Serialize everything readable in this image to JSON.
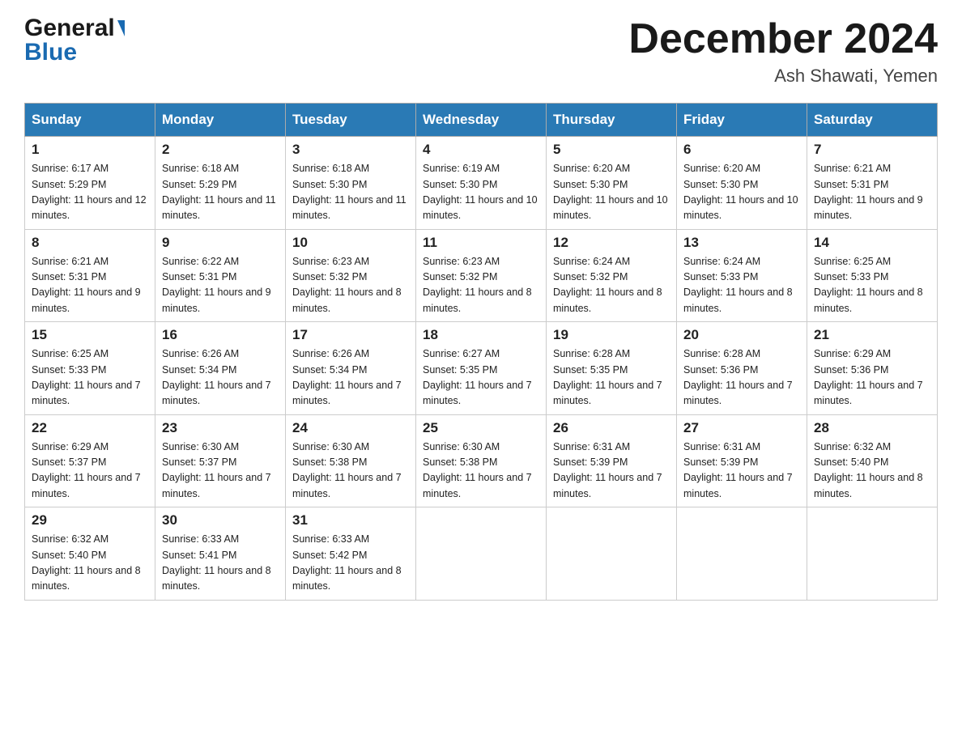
{
  "header": {
    "logo_line1": "General",
    "logo_arrow": "▶",
    "logo_line2": "Blue",
    "month_title": "December 2024",
    "location": "Ash Shawati, Yemen"
  },
  "calendar": {
    "days_of_week": [
      "Sunday",
      "Monday",
      "Tuesday",
      "Wednesday",
      "Thursday",
      "Friday",
      "Saturday"
    ],
    "weeks": [
      [
        {
          "day": "1",
          "sunrise": "Sunrise: 6:17 AM",
          "sunset": "Sunset: 5:29 PM",
          "daylight": "Daylight: 11 hours and 12 minutes."
        },
        {
          "day": "2",
          "sunrise": "Sunrise: 6:18 AM",
          "sunset": "Sunset: 5:29 PM",
          "daylight": "Daylight: 11 hours and 11 minutes."
        },
        {
          "day": "3",
          "sunrise": "Sunrise: 6:18 AM",
          "sunset": "Sunset: 5:30 PM",
          "daylight": "Daylight: 11 hours and 11 minutes."
        },
        {
          "day": "4",
          "sunrise": "Sunrise: 6:19 AM",
          "sunset": "Sunset: 5:30 PM",
          "daylight": "Daylight: 11 hours and 10 minutes."
        },
        {
          "day": "5",
          "sunrise": "Sunrise: 6:20 AM",
          "sunset": "Sunset: 5:30 PM",
          "daylight": "Daylight: 11 hours and 10 minutes."
        },
        {
          "day": "6",
          "sunrise": "Sunrise: 6:20 AM",
          "sunset": "Sunset: 5:30 PM",
          "daylight": "Daylight: 11 hours and 10 minutes."
        },
        {
          "day": "7",
          "sunrise": "Sunrise: 6:21 AM",
          "sunset": "Sunset: 5:31 PM",
          "daylight": "Daylight: 11 hours and 9 minutes."
        }
      ],
      [
        {
          "day": "8",
          "sunrise": "Sunrise: 6:21 AM",
          "sunset": "Sunset: 5:31 PM",
          "daylight": "Daylight: 11 hours and 9 minutes."
        },
        {
          "day": "9",
          "sunrise": "Sunrise: 6:22 AM",
          "sunset": "Sunset: 5:31 PM",
          "daylight": "Daylight: 11 hours and 9 minutes."
        },
        {
          "day": "10",
          "sunrise": "Sunrise: 6:23 AM",
          "sunset": "Sunset: 5:32 PM",
          "daylight": "Daylight: 11 hours and 8 minutes."
        },
        {
          "day": "11",
          "sunrise": "Sunrise: 6:23 AM",
          "sunset": "Sunset: 5:32 PM",
          "daylight": "Daylight: 11 hours and 8 minutes."
        },
        {
          "day": "12",
          "sunrise": "Sunrise: 6:24 AM",
          "sunset": "Sunset: 5:32 PM",
          "daylight": "Daylight: 11 hours and 8 minutes."
        },
        {
          "day": "13",
          "sunrise": "Sunrise: 6:24 AM",
          "sunset": "Sunset: 5:33 PM",
          "daylight": "Daylight: 11 hours and 8 minutes."
        },
        {
          "day": "14",
          "sunrise": "Sunrise: 6:25 AM",
          "sunset": "Sunset: 5:33 PM",
          "daylight": "Daylight: 11 hours and 8 minutes."
        }
      ],
      [
        {
          "day": "15",
          "sunrise": "Sunrise: 6:25 AM",
          "sunset": "Sunset: 5:33 PM",
          "daylight": "Daylight: 11 hours and 7 minutes."
        },
        {
          "day": "16",
          "sunrise": "Sunrise: 6:26 AM",
          "sunset": "Sunset: 5:34 PM",
          "daylight": "Daylight: 11 hours and 7 minutes."
        },
        {
          "day": "17",
          "sunrise": "Sunrise: 6:26 AM",
          "sunset": "Sunset: 5:34 PM",
          "daylight": "Daylight: 11 hours and 7 minutes."
        },
        {
          "day": "18",
          "sunrise": "Sunrise: 6:27 AM",
          "sunset": "Sunset: 5:35 PM",
          "daylight": "Daylight: 11 hours and 7 minutes."
        },
        {
          "day": "19",
          "sunrise": "Sunrise: 6:28 AM",
          "sunset": "Sunset: 5:35 PM",
          "daylight": "Daylight: 11 hours and 7 minutes."
        },
        {
          "day": "20",
          "sunrise": "Sunrise: 6:28 AM",
          "sunset": "Sunset: 5:36 PM",
          "daylight": "Daylight: 11 hours and 7 minutes."
        },
        {
          "day": "21",
          "sunrise": "Sunrise: 6:29 AM",
          "sunset": "Sunset: 5:36 PM",
          "daylight": "Daylight: 11 hours and 7 minutes."
        }
      ],
      [
        {
          "day": "22",
          "sunrise": "Sunrise: 6:29 AM",
          "sunset": "Sunset: 5:37 PM",
          "daylight": "Daylight: 11 hours and 7 minutes."
        },
        {
          "day": "23",
          "sunrise": "Sunrise: 6:30 AM",
          "sunset": "Sunset: 5:37 PM",
          "daylight": "Daylight: 11 hours and 7 minutes."
        },
        {
          "day": "24",
          "sunrise": "Sunrise: 6:30 AM",
          "sunset": "Sunset: 5:38 PM",
          "daylight": "Daylight: 11 hours and 7 minutes."
        },
        {
          "day": "25",
          "sunrise": "Sunrise: 6:30 AM",
          "sunset": "Sunset: 5:38 PM",
          "daylight": "Daylight: 11 hours and 7 minutes."
        },
        {
          "day": "26",
          "sunrise": "Sunrise: 6:31 AM",
          "sunset": "Sunset: 5:39 PM",
          "daylight": "Daylight: 11 hours and 7 minutes."
        },
        {
          "day": "27",
          "sunrise": "Sunrise: 6:31 AM",
          "sunset": "Sunset: 5:39 PM",
          "daylight": "Daylight: 11 hours and 7 minutes."
        },
        {
          "day": "28",
          "sunrise": "Sunrise: 6:32 AM",
          "sunset": "Sunset: 5:40 PM",
          "daylight": "Daylight: 11 hours and 8 minutes."
        }
      ],
      [
        {
          "day": "29",
          "sunrise": "Sunrise: 6:32 AM",
          "sunset": "Sunset: 5:40 PM",
          "daylight": "Daylight: 11 hours and 8 minutes."
        },
        {
          "day": "30",
          "sunrise": "Sunrise: 6:33 AM",
          "sunset": "Sunset: 5:41 PM",
          "daylight": "Daylight: 11 hours and 8 minutes."
        },
        {
          "day": "31",
          "sunrise": "Sunrise: 6:33 AM",
          "sunset": "Sunset: 5:42 PM",
          "daylight": "Daylight: 11 hours and 8 minutes."
        },
        null,
        null,
        null,
        null
      ]
    ]
  }
}
